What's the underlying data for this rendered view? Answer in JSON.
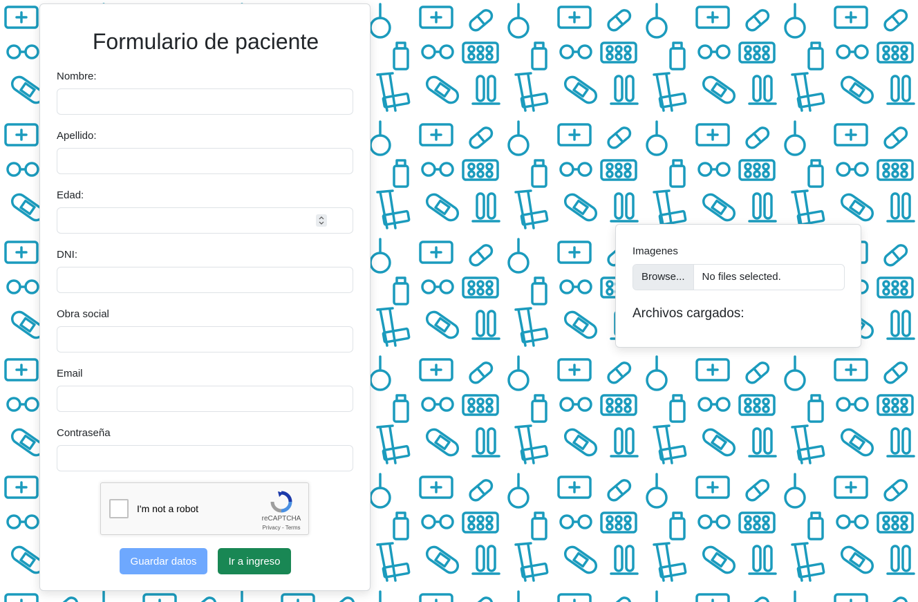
{
  "theme": {
    "pattern_color": "#1b9bbd",
    "primary_disabled": "#6ea8fe",
    "success": "#198754"
  },
  "form": {
    "title": "Formulario de paciente",
    "fields": [
      {
        "label": "Nombre:",
        "value": ""
      },
      {
        "label": "Apellido:",
        "value": ""
      },
      {
        "label": "Edad:",
        "value": ""
      },
      {
        "label": "DNI:",
        "value": ""
      },
      {
        "label": "Obra social",
        "value": ""
      },
      {
        "label": "Email",
        "value": ""
      },
      {
        "label": "Contraseña",
        "value": ""
      }
    ],
    "captcha": {
      "text": "I'm not a robot",
      "brand": "reCAPTCHA",
      "links": "Privacy - Terms"
    },
    "save_label": "Guardar datos",
    "go_label": "Ir a ingreso"
  },
  "upload": {
    "label": "Imagenes",
    "browse_label": "Browse...",
    "status": "No files selected.",
    "uploaded_title": "Archivos cargados:"
  }
}
